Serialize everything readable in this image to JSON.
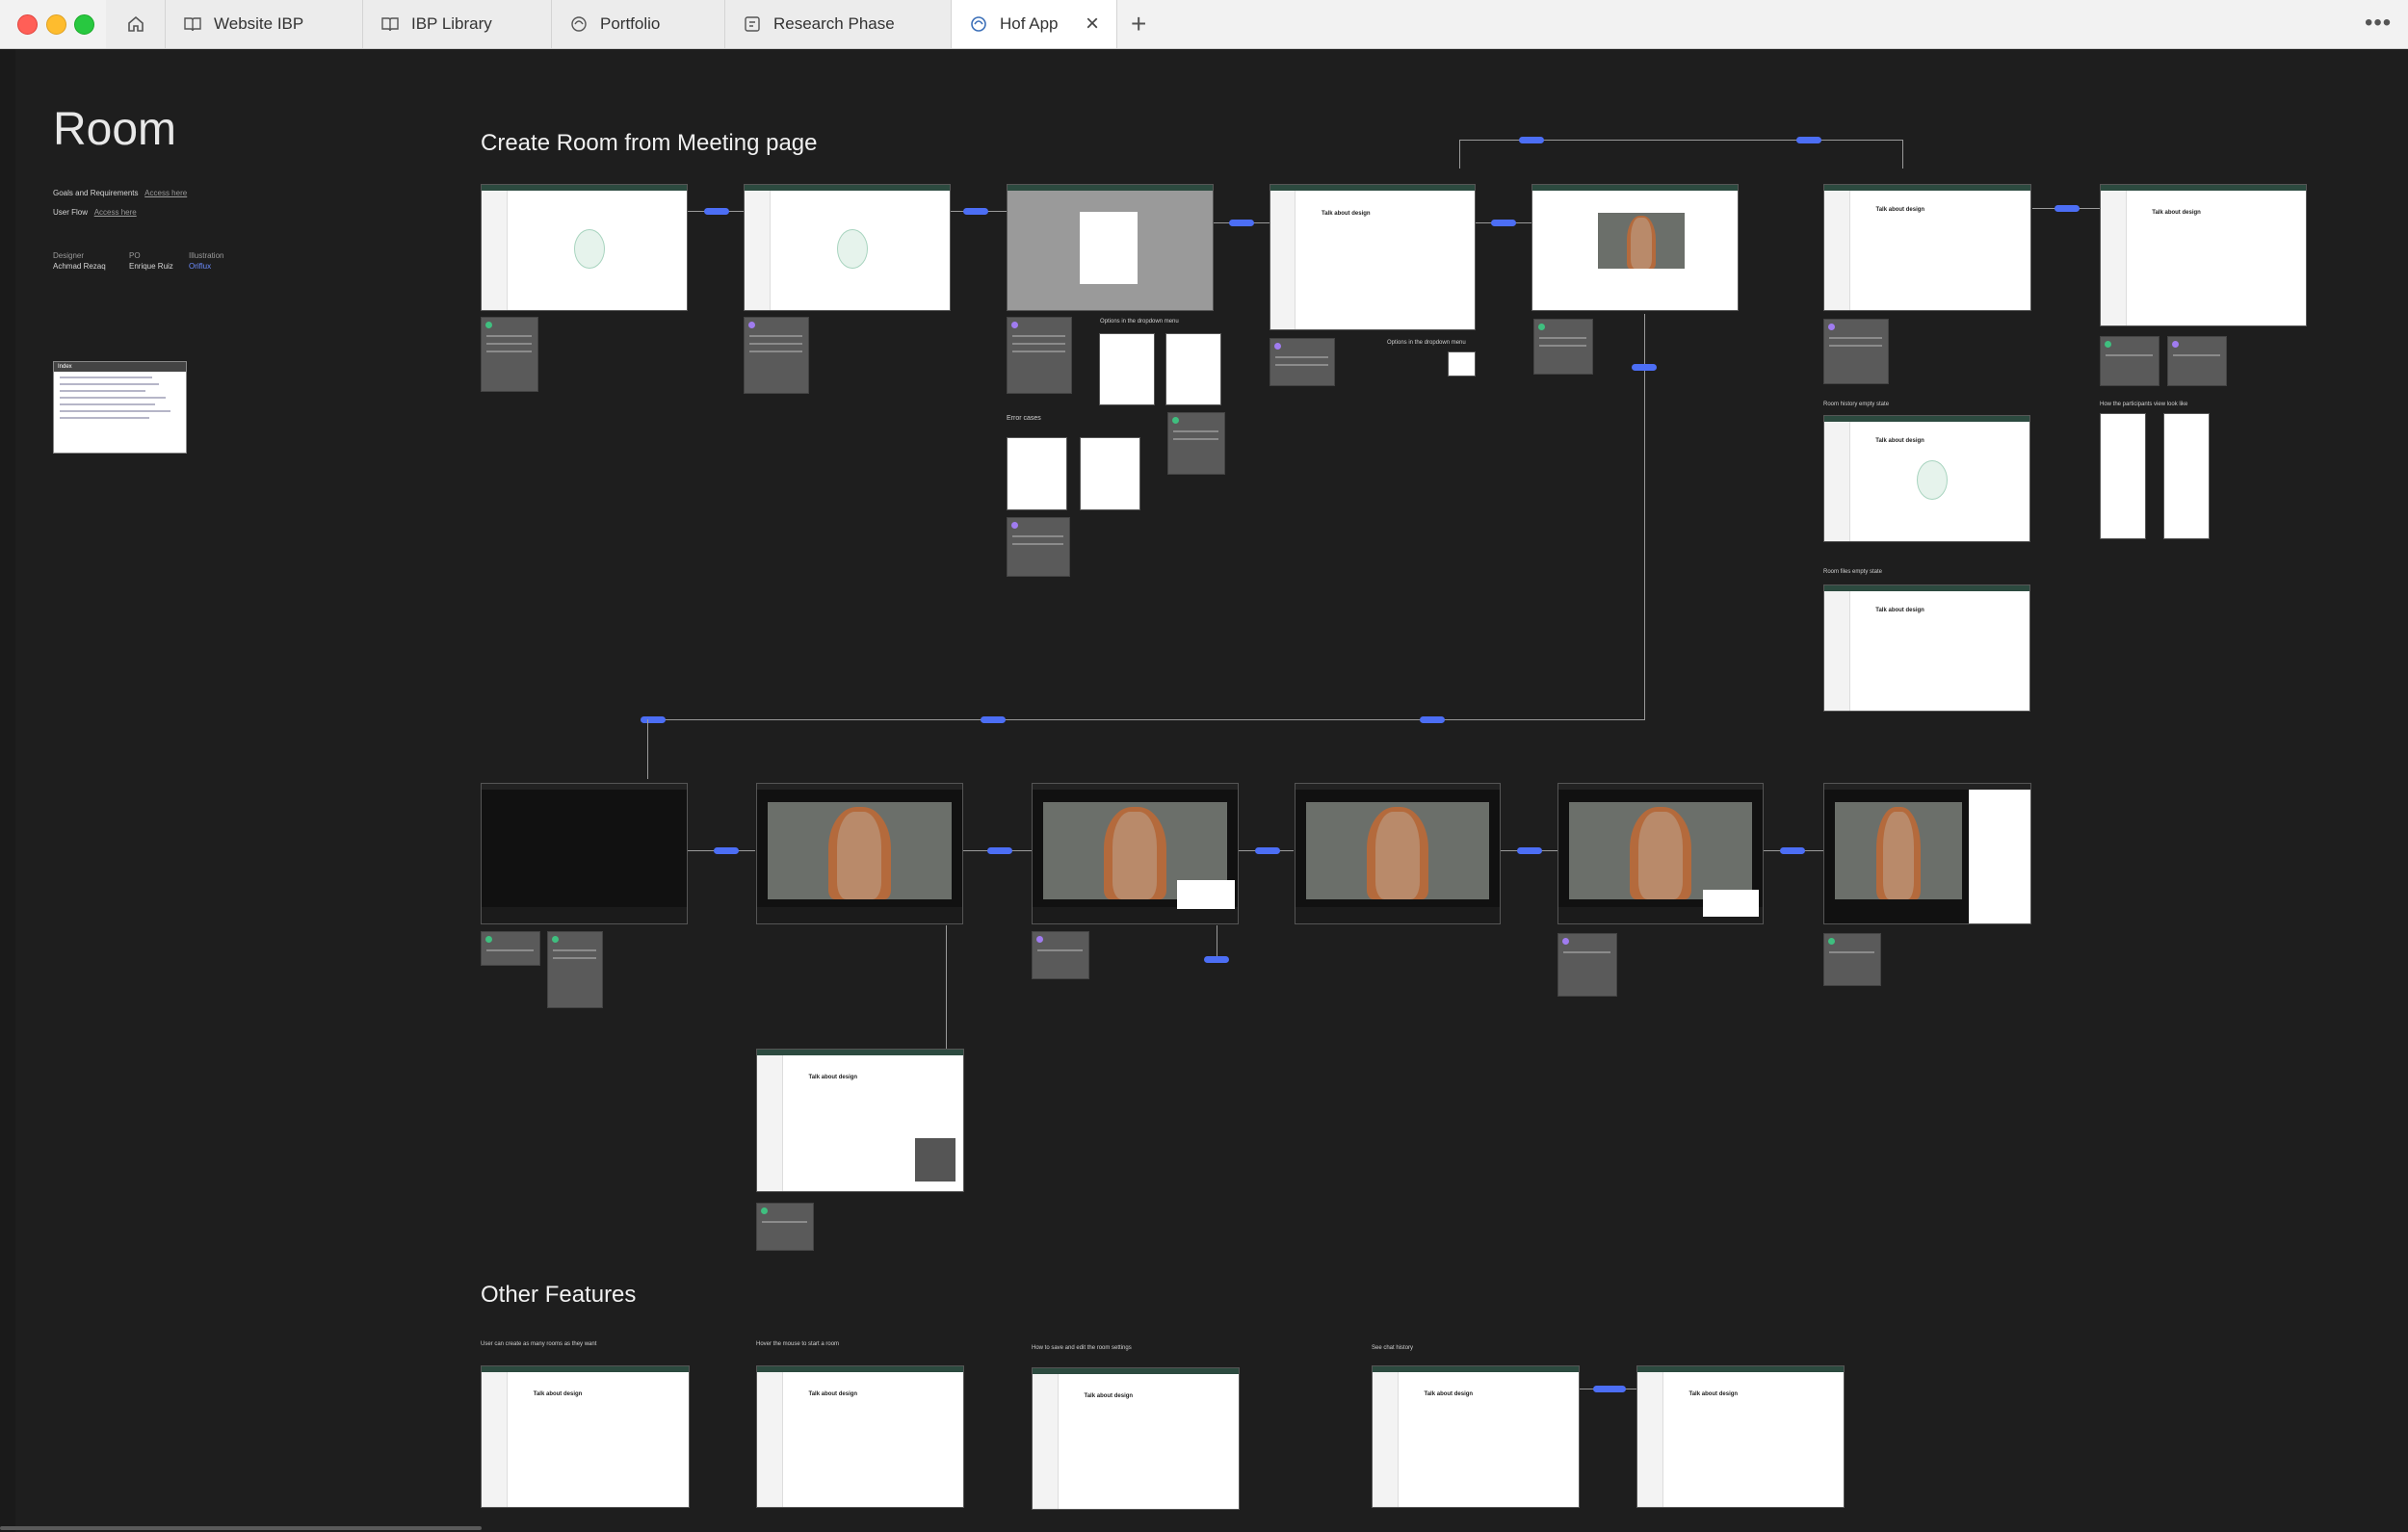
{
  "window": {
    "tabs": [
      {
        "label": "Website IBP",
        "icon": "book-icon",
        "active": false
      },
      {
        "label": "IBP Library",
        "icon": "book-icon",
        "active": false
      },
      {
        "label": "Portfolio",
        "icon": "figma-icon",
        "active": false
      },
      {
        "label": "Research Phase",
        "icon": "figjam-icon",
        "active": false
      },
      {
        "label": "Hof App",
        "icon": "figma-icon",
        "active": true
      }
    ],
    "new_tab_icon": "plus-icon",
    "more_icon": "ellipsis-icon",
    "home_icon": "home-icon"
  },
  "page": {
    "title": "Room",
    "goals_label": "Goals and Requirements",
    "goals_link": "Access here",
    "flow_label": "User Flow",
    "flow_link": "Access here",
    "designer_label": "Designer",
    "designer_name": "Achmad Rezaq",
    "po_label": "PO",
    "po_name": "Enrique Ruiz",
    "illustration_label": "Illustration",
    "illustration_name": "Oriflux",
    "index_title": "Index"
  },
  "sections": {
    "create_room": "Create Room from Meeting page",
    "other_features": "Other Features"
  },
  "captions": {
    "options_dropdown_1": "Options in the dropdown menu",
    "options_dropdown_2": "Options in the dropdown menu",
    "error_cases": "Error cases",
    "room_history_empty": "Room history empty state",
    "room_files_empty": "Room files empty state",
    "participants_view": "How the participants view look like",
    "feature_1": "User can create as many rooms as they want",
    "feature_2": "Hover the mouse to start a room",
    "feature_3": "How to save and edit the room settings",
    "feature_4": "See chat history"
  },
  "frames": {
    "talk_about_design": "Talk about design"
  },
  "colors": {
    "canvas_bg": "#1e1e1e",
    "connector_pill": "#4c6ef5",
    "app_header": "#2c4a3f"
  }
}
